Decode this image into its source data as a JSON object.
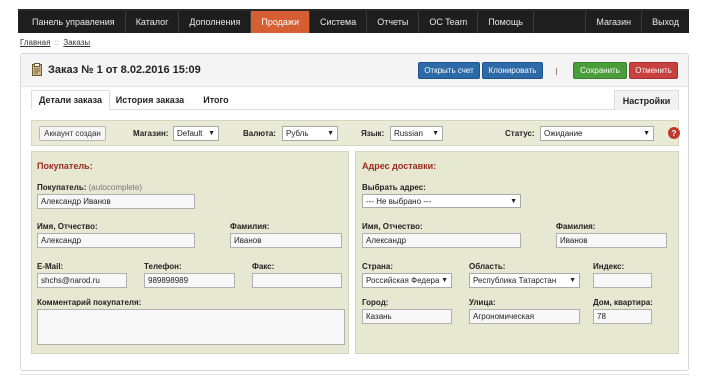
{
  "nav": {
    "items": [
      "Панель управления",
      "Каталог",
      "Дополнения",
      "Продажи",
      "Система",
      "Отчеты",
      "OC Team",
      "Помощь"
    ],
    "active": "Продажи",
    "right": [
      "Магазин",
      "Выход"
    ]
  },
  "breadcrumb": {
    "home": "Главная",
    "sep": "::",
    "current": "Заказы"
  },
  "header": {
    "title": "Заказ № 1 от 8.02.2016 15:09",
    "open_invoice": "Открыть счет",
    "clone": "Клонировать",
    "save": "Сохранить",
    "cancel": "Отменить"
  },
  "tabs": {
    "details": "Детали заказа",
    "history": "История заказа",
    "total": "Итого",
    "settings": "Настройки"
  },
  "filters": {
    "account_button": "Аккаунт создан",
    "store_label": "Магазин:",
    "store_value": "Default",
    "currency_label": "Валюта:",
    "currency_value": "Рубль",
    "language_label": "Язык:",
    "language_value": "Russian",
    "status_label": "Статус:",
    "status_value": "Ожидание"
  },
  "buyer": {
    "title": "Покупатель:",
    "customer_label": "Покупатель:",
    "customer_hint": "(autocomplete)",
    "customer_value": "Александр Иванов",
    "firstname_label": "Имя, Отчество:",
    "firstname_value": "Александр",
    "lastname_label": "Фамилия:",
    "lastname_value": "Иванов",
    "email_label": "E-Mail:",
    "email_value": "shchs@narod.ru",
    "phone_label": "Телефон:",
    "phone_value": "989898989",
    "fax_label": "Факс:",
    "fax_value": "",
    "comment_label": "Комментарий покупателя:"
  },
  "shipping": {
    "title": "Адрес доставки:",
    "choose_label": "Выбрать адрес:",
    "choose_value": "--- Не выбрано ---",
    "firstname_label": "Имя, Отчество:",
    "firstname_value": "Александр",
    "lastname_label": "Фамилия:",
    "lastname_value": "Иванов",
    "country_label": "Страна:",
    "country_value": "Российская Федера",
    "region_label": "Область:",
    "region_value": "Республика Татарстан",
    "index_label": "Индекс:",
    "index_value": "",
    "city_label": "Город:",
    "city_value": "Казань",
    "street_label": "Улица:",
    "street_value": "Агрономическая",
    "house_label": "Дом, квартира:",
    "house_value": "78"
  }
}
